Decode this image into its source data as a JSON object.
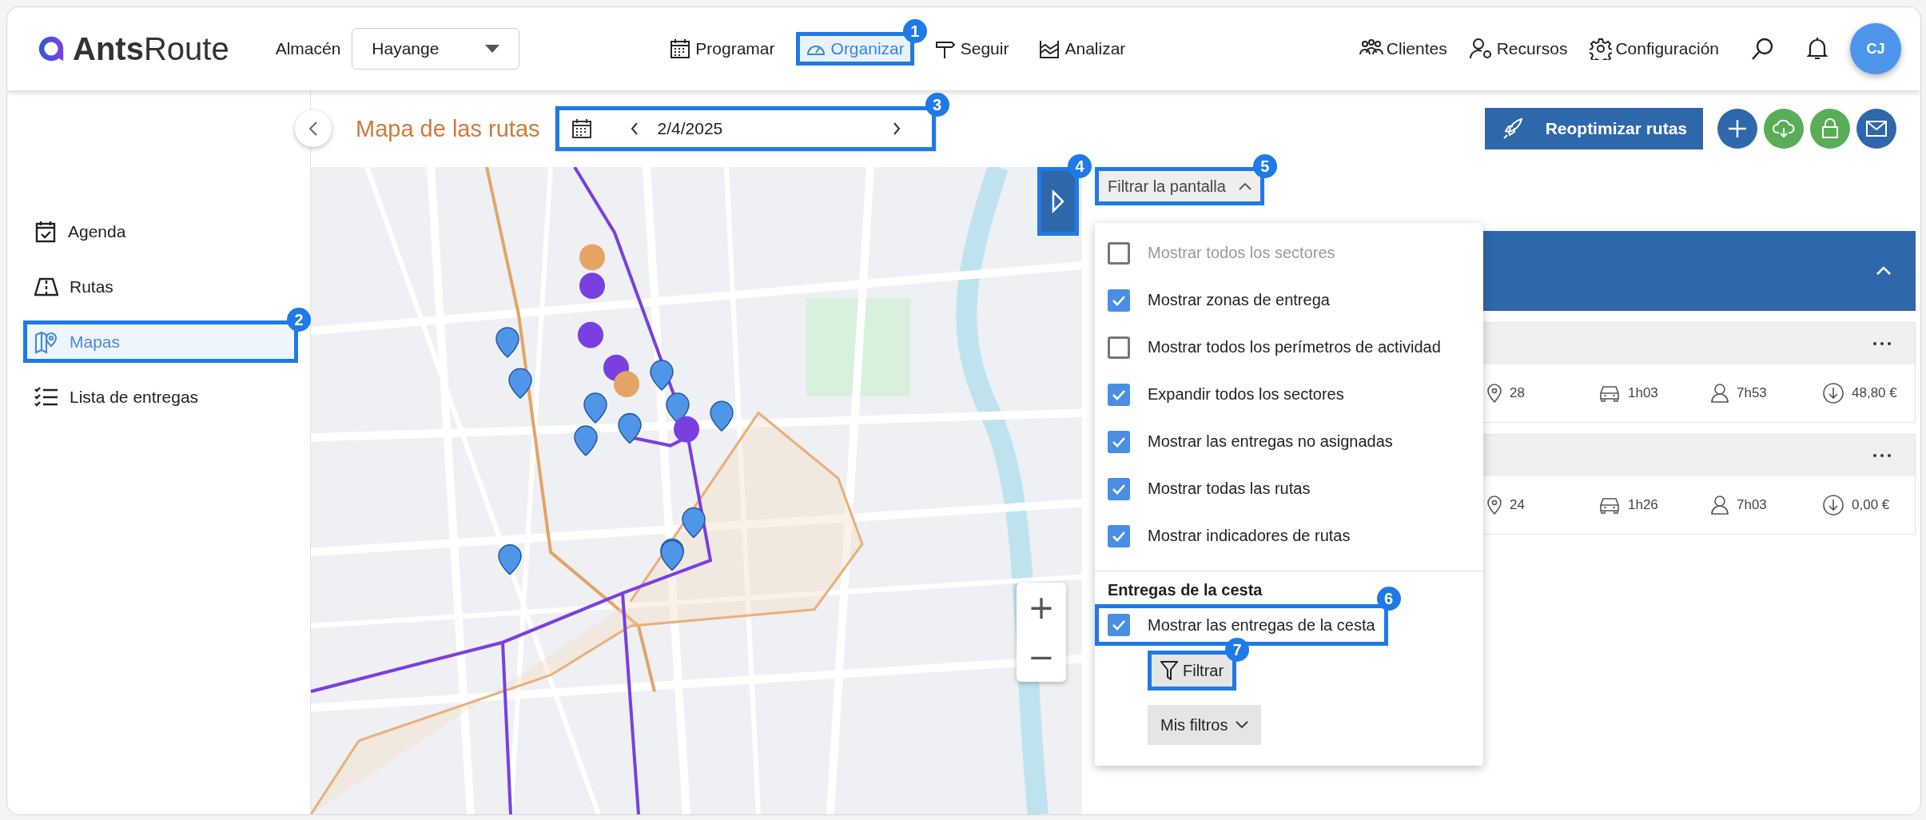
{
  "header": {
    "logo": {
      "bold": "Ants",
      "light": "Route"
    },
    "warehouse": {
      "label": "Almacén",
      "value": "Hayange"
    },
    "nav": [
      {
        "label": "Programar",
        "selected": false
      },
      {
        "label": "Organizar",
        "selected": true,
        "callout": "1"
      },
      {
        "label": "Seguir",
        "selected": false
      },
      {
        "label": "Analizar",
        "selected": false
      }
    ],
    "tools": [
      {
        "label": "Clientes"
      },
      {
        "label": "Recursos"
      },
      {
        "label": "Configuración"
      }
    ],
    "avatar": "CJ"
  },
  "sidebar": {
    "items": [
      {
        "label": "Agenda",
        "selected": false
      },
      {
        "label": "Rutas",
        "selected": false
      },
      {
        "label": "Mapas",
        "selected": true,
        "callout": "2"
      },
      {
        "label": "Lista de entregas",
        "selected": false
      }
    ]
  },
  "toolbar": {
    "title": "Mapa de las rutas",
    "date": {
      "value": "2/4/2025",
      "callout": "3"
    },
    "reoptimize": "Reoptimizar rutas",
    "actions": [
      {
        "kind": "add",
        "color": "#2f67ab"
      },
      {
        "kind": "cloud",
        "color": "#5aad57"
      },
      {
        "kind": "lock",
        "color": "#5aad57"
      },
      {
        "kind": "mail",
        "color": "#2f67ab"
      }
    ]
  },
  "map": {
    "zoom_controls": [
      "+",
      "−"
    ],
    "toggle": {
      "callout": "4"
    }
  },
  "panel": {
    "filter_button": {
      "label": "Filtrar la pantalla",
      "expanded": true,
      "callout": "5"
    },
    "section": {
      "expanded": true
    },
    "routes": [
      {
        "stops": "28",
        "drive": "1h03",
        "duration": "7h53",
        "cost": "48,80 €"
      },
      {
        "stops": "24",
        "drive": "1h26",
        "duration": "7h03",
        "cost": "0,00 €"
      }
    ],
    "menu": {
      "options": [
        {
          "label": "Mostrar todos los sectores",
          "checked": false,
          "disabled": true
        },
        {
          "label": "Mostrar zonas de entrega",
          "checked": true,
          "disabled": false
        },
        {
          "label": "Mostrar todos los perímetros de actividad",
          "checked": false,
          "disabled": false
        },
        {
          "label": "Expandir todos los sectores",
          "checked": true,
          "disabled": false
        },
        {
          "label": "Mostrar las entregas no asignadas",
          "checked": true,
          "disabled": false
        },
        {
          "label": "Mostrar todas las rutas",
          "checked": true,
          "disabled": false
        },
        {
          "label": "Mostrar indicadores de rutas",
          "checked": true,
          "disabled": false
        }
      ],
      "basket_heading": "Entregas de la cesta",
      "basket_option": {
        "label": "Mostrar las entregas de la cesta",
        "checked": true,
        "callout": "6"
      },
      "apply": {
        "label": "Filtrar",
        "callout": "7"
      },
      "saved": {
        "label": "Mis filtros"
      }
    }
  }
}
